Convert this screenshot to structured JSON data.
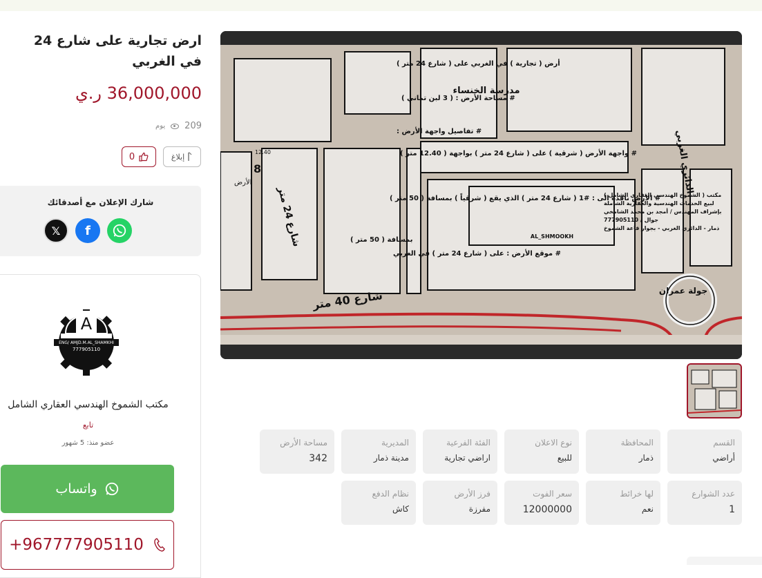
{
  "listing": {
    "title": "ارض تجارية على شارع 24 في الغربي",
    "price": "36,000,000 ر.ي",
    "views_count": "209",
    "views_unit": "يوم",
    "report_label": "إبلاغ",
    "likes_count": "0"
  },
  "share": {
    "title": "شارك الإعلان مع أصدقائك",
    "networks": [
      "x-icon",
      "facebook-icon",
      "whatsapp-icon"
    ]
  },
  "seller": {
    "name": "مكتب الشموخ الهندسي العقاري الشامل",
    "follow_label": "تابع",
    "member_since": "عضو منذ: 5 شهور",
    "logo_text": "ENG/ AMJD.M.AL_SHAMKHI",
    "logo_phone": "777905110",
    "whatsapp_label": "واتساب",
    "phone": "+967777905110"
  },
  "map_image": {
    "labels": {
      "street40": "شارع 40 متر",
      "street24": "شارع 24 متر",
      "school": "مدرسة الخنساء",
      "roundabout": "جولة عمران",
      "dairy_road": "الدائري الغربي",
      "land_marker": "الأرض",
      "dim": "12.40",
      "office_name": "AL_SHMOOKH",
      "office_phone": "777905110"
    },
    "notes": [
      "أرض ( تجارية ) في الغربي على ( شارع 24 متر )",
      "# مساحة الأرض : ( 3 لبن تماني )",
      "# تفاصيل واجهة الأرض :",
      "# واجهة الأرض ( شرقية ) على ( شارع 24 متر ) بواجهة ( 12.40 متر )",
      "# الأرض نافذة الى : #1 ( شارع 24 متر ) الذي يقع ( شرقياً ) بمسافة ( 50 متر )",
      "# موقع الأرض : على ( شارع 24 متر ) في الغربي"
    ],
    "office_note": [
      "مكتب ( الشموخ الهندسي العقاري الشامل )",
      "لبيع الخدمات الهندسية والعقارية الشاملة",
      "بإشراف المهندس / أمجد بن محمد الشامخي",
      "جوال / 777905110",
      "ذمار - الدائري الغربي - بجوار قاعة الشموخ"
    ]
  },
  "details": [
    {
      "label": "القسم",
      "value": "أراضي"
    },
    {
      "label": "المحافظة",
      "value": "ذمار"
    },
    {
      "label": "نوع الاعلان",
      "value": "للبيع"
    },
    {
      "label": "الفئة الفرعية",
      "value": "اراضي تجارية"
    },
    {
      "label": "المديرية",
      "value": "مدينة ذمار"
    },
    {
      "label": "مساحة الأرض",
      "value": "342"
    },
    {
      "label": "عدد الشوارع",
      "value": "1"
    },
    {
      "label": "لها خرائط",
      "value": "نعم"
    },
    {
      "label": "سعر الفوت",
      "value": "12000000"
    },
    {
      "label": "فرز الأرض",
      "value": "مفرزة"
    },
    {
      "label": "نظام الدفع",
      "value": "كاش"
    }
  ],
  "colors": {
    "accent": "#a0162a",
    "whatsapp_green": "#5cb85c",
    "box_bg": "#efefef"
  }
}
